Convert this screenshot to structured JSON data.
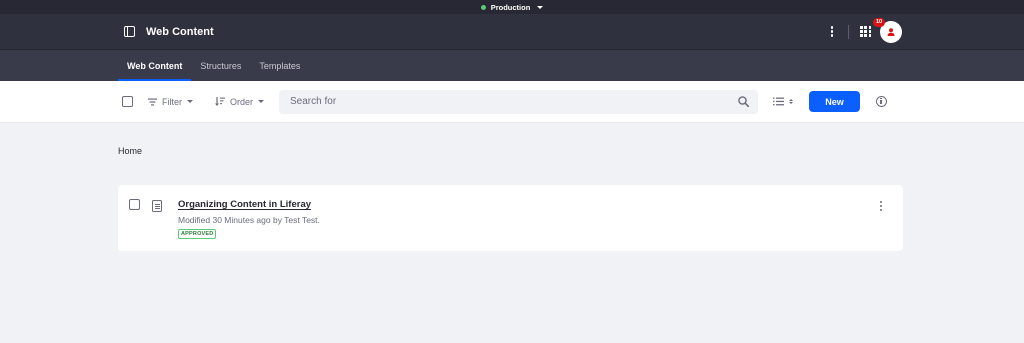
{
  "environment": {
    "label": "Production",
    "dot_color": "#5aca75"
  },
  "control_menu": {
    "title": "Web Content",
    "notification_count": "10",
    "icons": [
      "panel-icon",
      "options-kebab-icon",
      "applications-grid-icon",
      "user-avatar-icon"
    ]
  },
  "nav": {
    "tabs": [
      {
        "label": "Web Content",
        "active": true
      },
      {
        "label": "Structures",
        "active": false
      },
      {
        "label": "Templates",
        "active": false
      }
    ]
  },
  "toolbar": {
    "filter_label": "Filter",
    "order_label": "Order",
    "search_placeholder": "Search for",
    "new_label": "New"
  },
  "breadcrumb": {
    "current": "Home"
  },
  "items": [
    {
      "title": "Organizing Content in Liferay",
      "meta": "Modified 30 Minutes ago by Test Test.",
      "status": "APPROVED",
      "status_color": "#287d3c"
    }
  ],
  "colors": {
    "primary": "#0b5fff",
    "control_menu_bg": "#30313f",
    "nav_bg": "#393a4a",
    "page_bg": "#f1f2f5"
  }
}
